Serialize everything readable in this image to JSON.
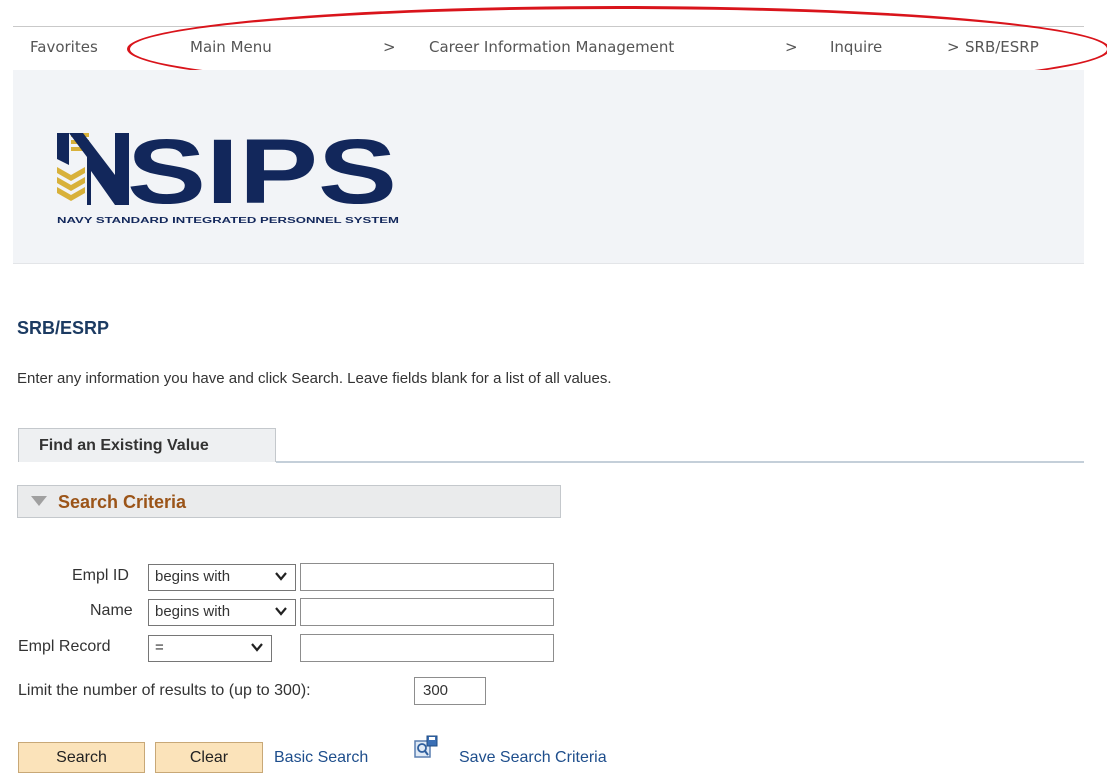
{
  "breadcrumb": {
    "items": [
      "Favorites",
      "Main Menu",
      "Career Information Management",
      "Inquire",
      "SRB/ESRP"
    ],
    "separator": ">"
  },
  "logo": {
    "text": "NSIPS",
    "subtitle": "NAVY STANDARD INTEGRATED PERSONNEL SYSTEM",
    "colors": {
      "navy": "#12275b",
      "gold": "#d8b13a"
    }
  },
  "page": {
    "title": "SRB/ESRP",
    "instructions": "Enter any information you have and click Search. Leave fields blank for a list of all values."
  },
  "tab": {
    "label": "Find an Existing Value"
  },
  "search_criteria": {
    "header": "Search Criteria",
    "fields": [
      {
        "label": "Empl ID",
        "operator": "begins with",
        "value": ""
      },
      {
        "label": "Name",
        "operator": "begins with",
        "value": ""
      },
      {
        "label": "Empl Record",
        "operator": "=",
        "value": ""
      }
    ],
    "limit_label": "Limit the number of results to (up to 300):",
    "limit_value": "300"
  },
  "actions": {
    "search": "Search",
    "clear": "Clear",
    "basic_search": "Basic Search",
    "save_search_criteria": "Save Search Criteria"
  },
  "icons": {
    "chevron": "chevron-down-icon",
    "save": "save-search-icon",
    "collapse": "collapse-triangle-icon"
  },
  "colors": {
    "title": "#1c3b62",
    "section_header": "#9b5418",
    "link": "#1e4e8c",
    "button": "#fbe3ba",
    "annotation": "#d9141b"
  }
}
